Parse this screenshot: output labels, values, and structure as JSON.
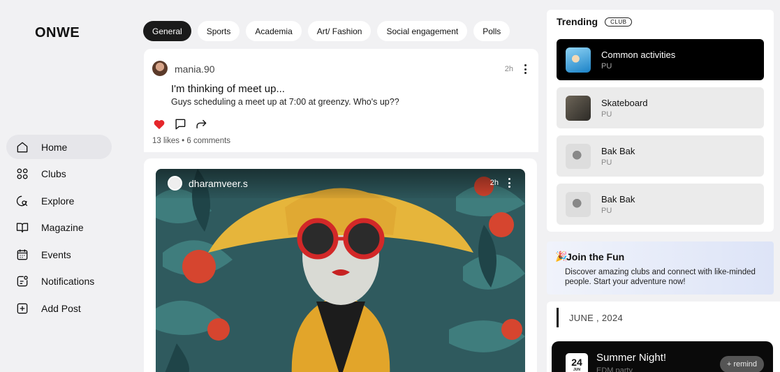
{
  "app": {
    "logo": "ONWE"
  },
  "sidebar": {
    "items": [
      {
        "label": "Home",
        "icon": "home-icon"
      },
      {
        "label": "Clubs",
        "icon": "grid-icon"
      },
      {
        "label": "Explore",
        "icon": "explore-icon"
      },
      {
        "label": "Magazine",
        "icon": "book-icon"
      },
      {
        "label": "Events",
        "icon": "calendar-icon"
      },
      {
        "label": "Notifications",
        "icon": "notification-icon"
      },
      {
        "label": "Add Post",
        "icon": "plus-square-icon"
      }
    ],
    "active": "Home"
  },
  "tabs": [
    {
      "label": "General",
      "active": true
    },
    {
      "label": "Sports"
    },
    {
      "label": "Academia"
    },
    {
      "label": "Art/ Fashion"
    },
    {
      "label": "Social engagement"
    },
    {
      "label": "Polls"
    }
  ],
  "feed": {
    "posts": [
      {
        "username": "mania.90",
        "time": "2h",
        "title": "I'm thinking of meet up...",
        "body": "Guys scheduling a meet up at 7:00 at greenzy. Who's up??",
        "stats": "13 likes • 6 comments",
        "liked": true
      },
      {
        "username": "dharamveer.s",
        "time": "2h",
        "image": "illustration-woman-yellow-hat-red-sunglasses"
      }
    ]
  },
  "trending": {
    "title": "Trending",
    "badge": "CLUB",
    "clubs": [
      {
        "name": "Common activities",
        "sub": "PU",
        "active": true
      },
      {
        "name": "Skateboard",
        "sub": "PU"
      },
      {
        "name": "Bak Bak",
        "sub": "PU"
      },
      {
        "name": "Bak Bak",
        "sub": "PU"
      }
    ]
  },
  "promo": {
    "icon": "🎉",
    "title": "Join the Fun",
    "text": "Discover amazing clubs and connect with like-minded people. Start your adventure now!"
  },
  "calendar": {
    "month": "JUNE , 2024",
    "events": [
      {
        "day": "24",
        "mon": "JUN",
        "name": "Summer Night!",
        "sub": "EDM party",
        "action": "+ remind"
      }
    ]
  },
  "colors": {
    "accent": "#000000",
    "like": "#e5262b",
    "background": "#f1f1f3"
  }
}
